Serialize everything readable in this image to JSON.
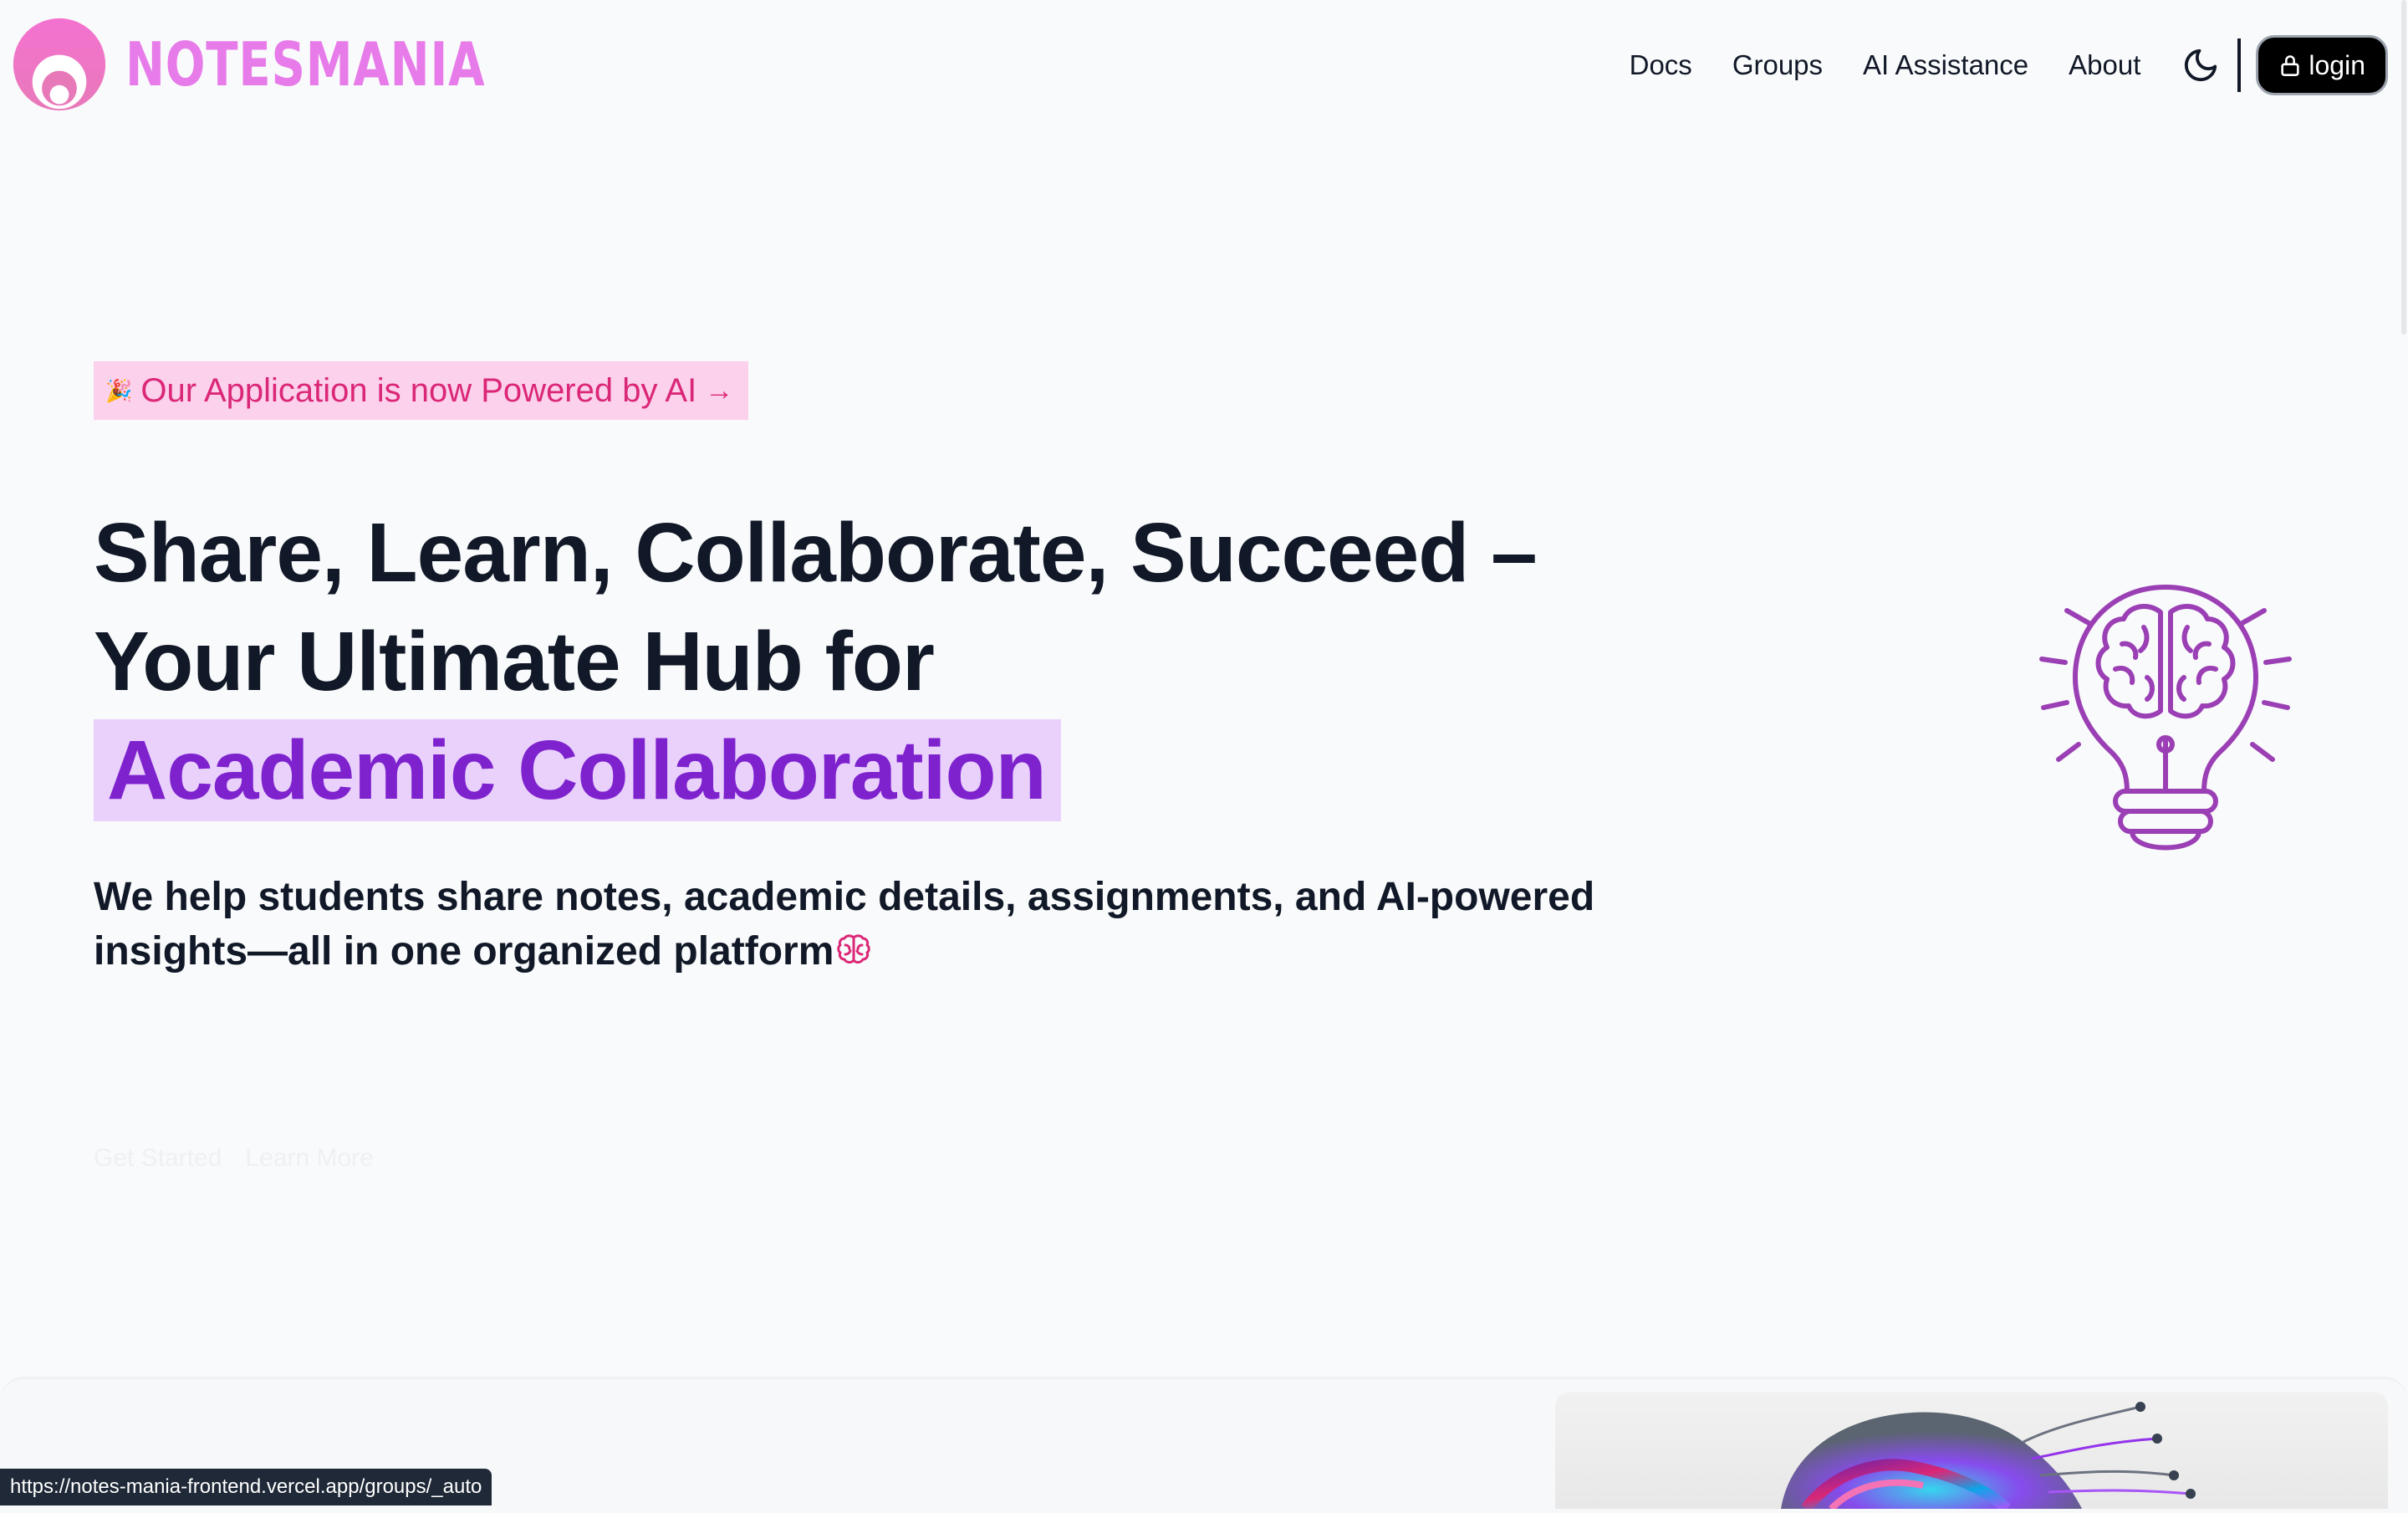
{
  "brand": {
    "name": "NOTESMANIA"
  },
  "nav": {
    "links": [
      "Docs",
      "Groups",
      "AI Assistance",
      "About"
    ],
    "login_label": "login"
  },
  "hero": {
    "announcement": {
      "icon": "🎉",
      "text": "Our Application is now Powered by AI",
      "arrow": "→"
    },
    "title_line1": "Share, Learn, Collaborate, Succeed –",
    "title_line2": "Your Ultimate Hub for",
    "title_highlight": "Academic Collaboration",
    "subtitle": "We help students share notes, academic details, assignments, and AI-powered insights—all in one organized platform",
    "buttons": {
      "get_started": "Get Started",
      "learn_more": "Learn More"
    }
  },
  "status_bar": {
    "url": "https://notes-mania-frontend.vercel.app/groups/_auto"
  },
  "icons": {
    "logo": "notesmania-logo-icon",
    "theme": "moon-icon",
    "lock": "lock-icon",
    "brain": "brain-icon",
    "bulb": "lightbulb-brain-icon"
  },
  "colors": {
    "brand_pink": "#e77be9",
    "announcement_bg": "#fbd1ec",
    "announcement_text": "#db2777",
    "highlight_bg": "#e9d1fc",
    "highlight_text": "#7e22ce",
    "illustration_purple": "#9b3fb5",
    "page_bg": "#f9fafb"
  }
}
